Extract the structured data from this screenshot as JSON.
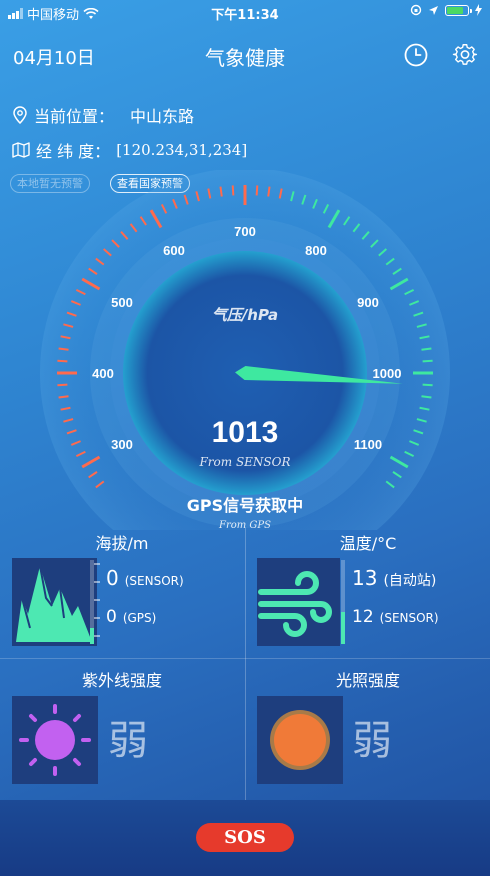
{
  "status_bar": {
    "carrier": "中国移动",
    "time": "下午11:34"
  },
  "nav": {
    "date": "04月10日",
    "title": "气象健康",
    "history_icon": "clock-icon",
    "settings_icon": "gear-icon"
  },
  "location": {
    "label": "当前位置：",
    "value": "中山东路"
  },
  "coords": {
    "label": "经 纬 度：",
    "value": "[120.234,31,234]"
  },
  "alerts": {
    "local": "本地暂无预警",
    "national": "查看国家预警"
  },
  "gauge": {
    "unit_label": "气压/hPa",
    "value": 1013,
    "value_text": "1013",
    "source": "From SENSOR",
    "min": 250,
    "max": 1150,
    "tick_labels": [
      "300",
      "400",
      "500",
      "600",
      "700",
      "800",
      "900",
      "1000",
      "1100"
    ],
    "colors": {
      "low": "#ff6a4d",
      "high": "#3ee8a0",
      "needle": "#3ee8a0"
    }
  },
  "gps": {
    "status": "GPS信号获取中",
    "source": "From GPS"
  },
  "altitude": {
    "title": "海拔/m",
    "sensor_value": "0",
    "sensor_label": "(SENSOR)",
    "gps_value": "0",
    "gps_label": "(GPS)",
    "icon": "mountain-icon"
  },
  "temperature": {
    "title": "温度/°C",
    "station_value": "13",
    "station_label": "(自动站)",
    "sensor_value": "12",
    "sensor_label": "(SENSOR)",
    "icon": "wind-icon"
  },
  "uv": {
    "title": "紫外线强度",
    "level": "弱",
    "icon": "sun-icon"
  },
  "light": {
    "title": "光照强度",
    "level": "弱",
    "icon": "light-circle-icon"
  },
  "sos": {
    "label": "SOS"
  }
}
